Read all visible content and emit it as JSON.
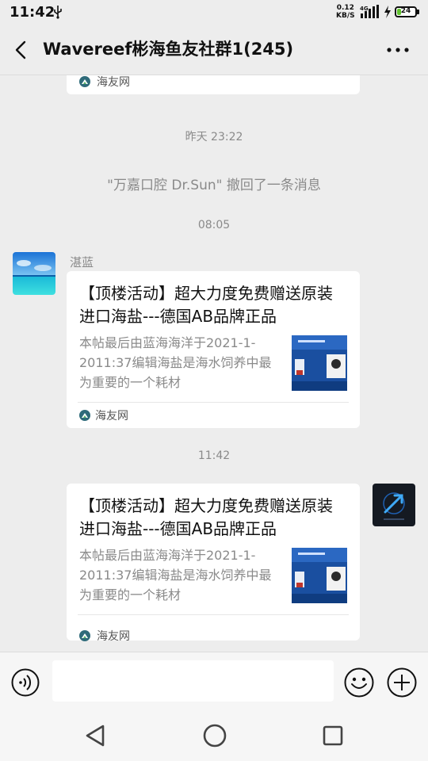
{
  "status_bar": {
    "time": "11:42",
    "net_speed_value": "0.12",
    "net_speed_unit": "KB/S",
    "network_type": "4G",
    "battery_level": "24",
    "battery_color": "#62c42f"
  },
  "header": {
    "title": "Wavereef彬海鱼友社群1(245)",
    "back_icon": "chevron-left-icon",
    "more_icon": "more-dots-icon"
  },
  "chat": {
    "previous_card": {
      "source": "海友网"
    },
    "timestamps": [
      "昨天 23:22",
      "08:05",
      "11:42"
    ],
    "system_message": "\"万嘉口腔 Dr.Sun\" 撤回了一条消息",
    "messages": [
      {
        "sender": "湛蓝",
        "title": "【顶楼活动】超大力度免费赠送原装进口海盐---德国AB品牌正品",
        "description": "本帖最后由蓝海海洋于2021-1-2011:37编辑海盐是海水饲养中最为重要的一个耗材",
        "source": "海友网"
      },
      {
        "sender": "",
        "title": "【顶楼活动】超大力度免费赠送原装进口海盐---德国AB品牌正品",
        "description": "本帖最后由蓝海海洋于2021-1-2011:37编辑海盐是海水饲养中最为重要的一个耗材",
        "source": "海友网"
      }
    ]
  },
  "input_bar": {
    "placeholder": "",
    "voice_icon": "voice-icon",
    "emoji_icon": "emoji-icon",
    "plus_icon": "plus-icon"
  },
  "colors": {
    "background": "#ededed",
    "card": "#ffffff",
    "muted_text": "#8a8a8a"
  }
}
